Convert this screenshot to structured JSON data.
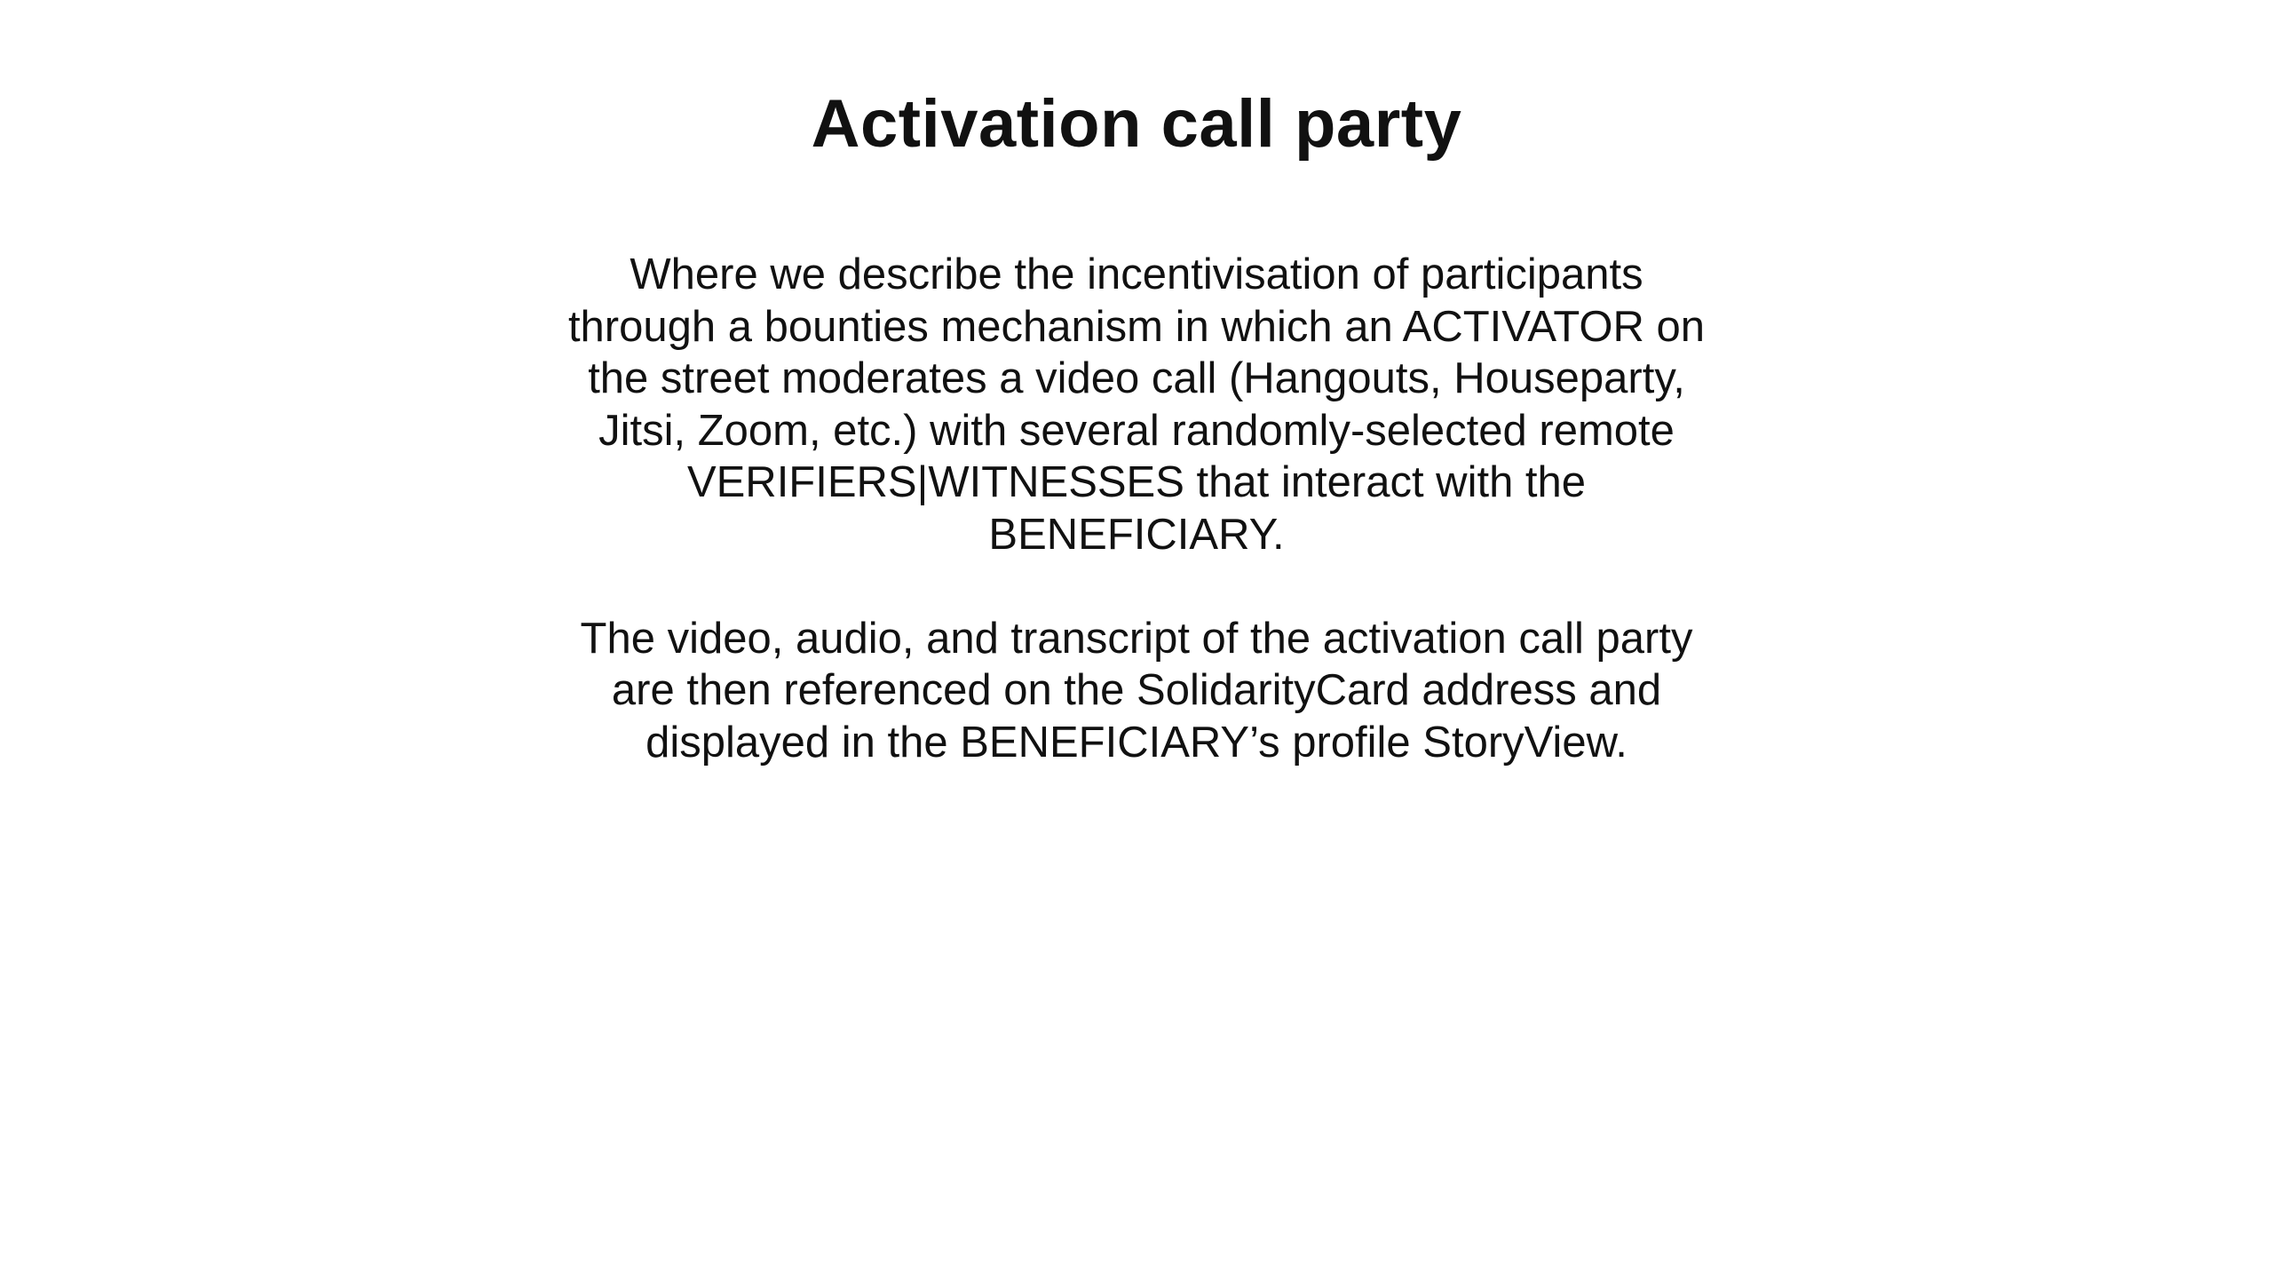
{
  "slide": {
    "title": "Activation call party",
    "paragraphs": [
      "Where we describe the incentivisation of participants through a bounties mechanism in which an ACTIVATOR on the street moderates a video call (Hangouts, Houseparty, Jitsi, Zoom, etc.) with several randomly-selected remote VERIFIERS|WITNESSES that interact with the BENEFICIARY.",
      "The video, audio, and transcript of the activation call party are then referenced on the SolidarityCard address and displayed in the BENEFICIARY’s profile StoryView."
    ]
  },
  "colors": {
    "background": "#ffffff",
    "text": "#111111"
  }
}
